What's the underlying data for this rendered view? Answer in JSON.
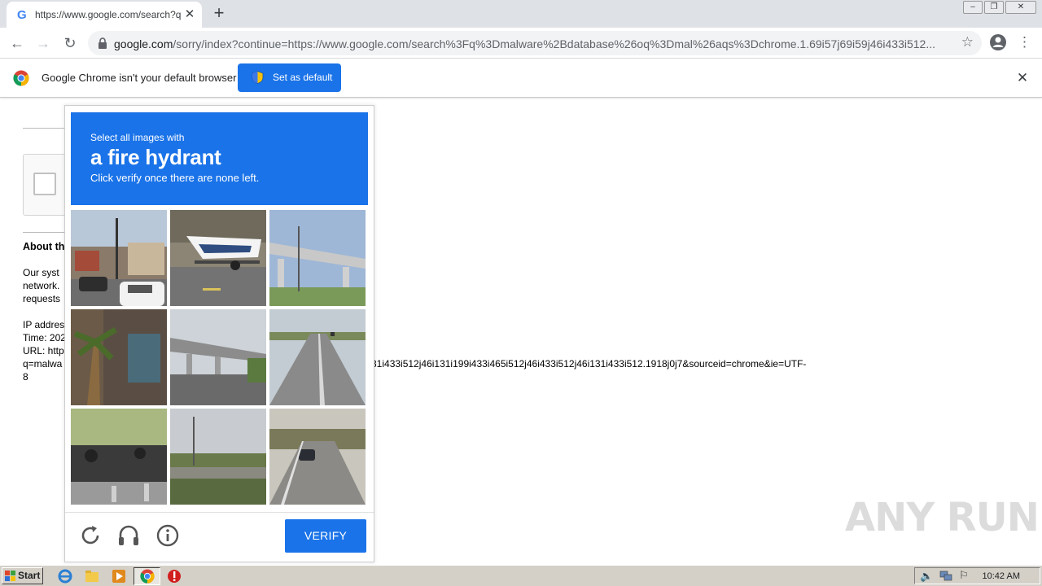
{
  "browser": {
    "tab_title": "https://www.google.com/search?q=malware+database&oq=mal&aqs=chrome",
    "tab_close": "✕",
    "new_tab": "+",
    "url_host": "google.com",
    "url_rest": "/sorry/index?continue=https://www.google.com/search%3Fq%3Dmalware%2Bdatabase%26oq%3Dmal%26aqs%3Dchrome.1.69i57j69i59j46i433i512...",
    "window_controls": [
      "minimize",
      "restore",
      "close"
    ]
  },
  "infobar": {
    "message": "Google Chrome isn't your default browser",
    "button_label": "Set as default",
    "close": "✕"
  },
  "page": {
    "about_heading": "About th",
    "lines": [
      "Our syst",
      "network.",
      "requests",
      "IP addres",
      "Time: 202",
      "URL: http",
      "q=malwa",
      "8"
    ],
    "url_tail": "31i433i512j46i131i199i433i465i512j46i433i512j46i131i433i512.1918j0j7&sourceid=chrome&ie=UTF-"
  },
  "captcha": {
    "instruction_small": "Select all images with",
    "target": "a fire hydrant",
    "instruction_note": "Click verify once there are none left.",
    "tiles": [
      {
        "icon": "street-intersection"
      },
      {
        "icon": "boat-on-trailer"
      },
      {
        "icon": "highway-overpass"
      },
      {
        "icon": "palm-tree-mural"
      },
      {
        "icon": "elevated-railway"
      },
      {
        "icon": "rural-road"
      },
      {
        "icon": "motorcycles-street"
      },
      {
        "icon": "riverside-path"
      },
      {
        "icon": "road-with-car"
      }
    ],
    "verify_label": "VERIFY",
    "brand_color": "#1a73e8"
  },
  "watermark": "ANY RUN",
  "taskbar": {
    "start_label": "Start",
    "clock": "10:42 AM"
  }
}
